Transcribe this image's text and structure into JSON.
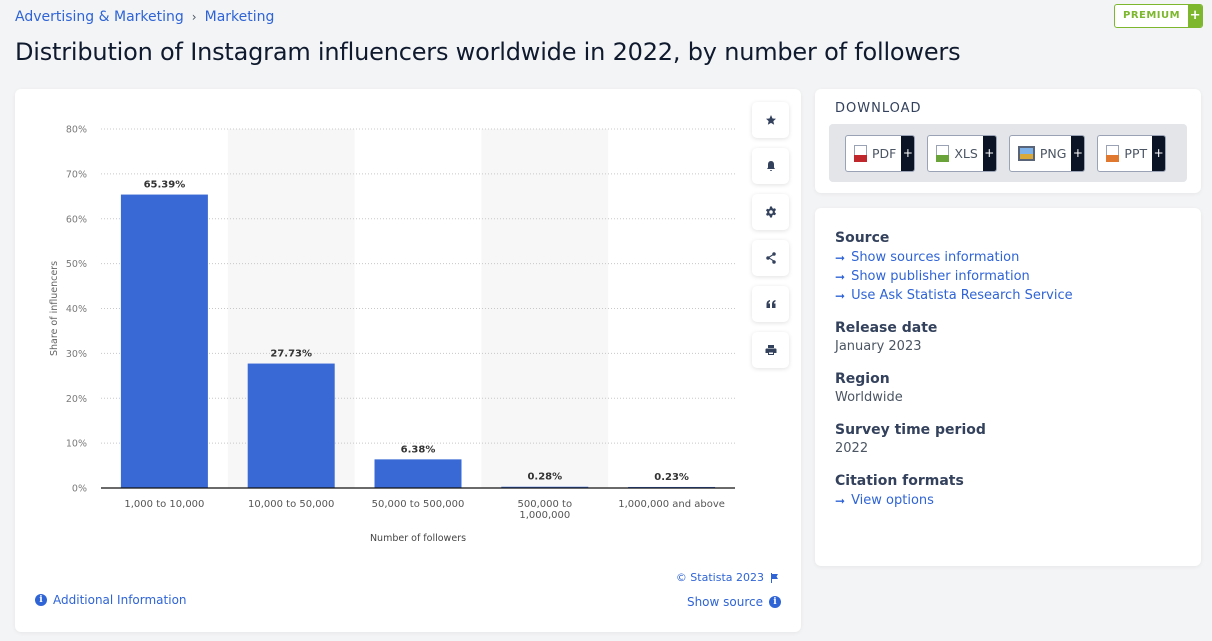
{
  "breadcrumb": {
    "items": [
      "Advertising & Marketing",
      "Marketing"
    ],
    "separator": "›"
  },
  "premium": {
    "label": "PREMIUM",
    "plus": "+"
  },
  "title": "Distribution of Instagram influencers worldwide in 2022, by number of followers",
  "colors": {
    "bar": "#3869d4",
    "accent": "#2f64d6",
    "premium": "#7cb72e",
    "column_band": "#f7f7f7"
  },
  "chart_data": {
    "type": "bar",
    "title": "Distribution of Instagram influencers worldwide in 2022, by number of followers",
    "categories": [
      "1,000 to 10,000",
      "10,000 to 50,000",
      "50,000 to 500,000",
      "500,000 to 1,000,000",
      "1,000,000 and above"
    ],
    "category_lines": [
      [
        "1,000 to 10,000"
      ],
      [
        "10,000 to 50,000"
      ],
      [
        "50,000 to 500,000"
      ],
      [
        "500,000 to",
        "1,000,000"
      ],
      [
        "1,000,000 and above"
      ]
    ],
    "values": [
      65.39,
      27.73,
      6.38,
      0.28,
      0.23
    ],
    "data_labels": [
      "65.39%",
      "27.73%",
      "6.38%",
      "0.28%",
      "0.23%"
    ],
    "xlabel": "Number of followers",
    "ylabel": "Share of influencers",
    "ylim": [
      0,
      80
    ],
    "yticks": [
      0,
      10,
      20,
      30,
      40,
      50,
      60,
      70,
      80
    ],
    "ytick_labels": [
      "0%",
      "10%",
      "20%",
      "30%",
      "40%",
      "50%",
      "60%",
      "70%",
      "80%"
    ],
    "grid": true,
    "legend": "none"
  },
  "tools": [
    {
      "name": "favorite",
      "icon": "star-icon"
    },
    {
      "name": "notification",
      "icon": "bell-icon"
    },
    {
      "name": "settings",
      "icon": "gear-icon"
    },
    {
      "name": "share",
      "icon": "share-icon"
    },
    {
      "name": "cite",
      "icon": "quote-icon"
    },
    {
      "name": "print",
      "icon": "print-icon"
    }
  ],
  "footer": {
    "copyright": "© Statista 2023",
    "show_source": "Show source",
    "additional_info": "Additional Information"
  },
  "download": {
    "title": "DOWNLOAD",
    "buttons": [
      {
        "label": "PDF",
        "plus": "+",
        "color": "#c0272d"
      },
      {
        "label": "XLS",
        "plus": "+",
        "color": "#6aa339"
      },
      {
        "label": "PNG",
        "plus": "+",
        "color": "#3d79c9"
      },
      {
        "label": "PPT",
        "plus": "+",
        "color": "#e0782f"
      }
    ]
  },
  "info": {
    "source_heading": "Source",
    "source_links": [
      "Show sources information",
      "Show publisher information",
      "Use Ask Statista Research Service"
    ],
    "release_heading": "Release date",
    "release_value": "January 2023",
    "region_heading": "Region",
    "region_value": "Worldwide",
    "survey_heading": "Survey time period",
    "survey_value": "2022",
    "citation_heading": "Citation formats",
    "citation_link": "View options"
  }
}
